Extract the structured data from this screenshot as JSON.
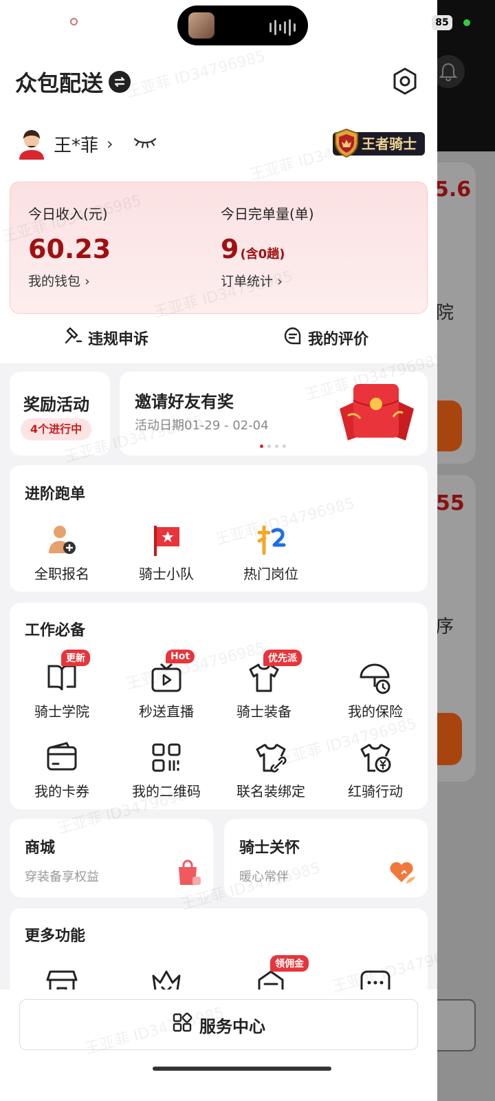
{
  "status": {
    "battery": "85"
  },
  "header": {
    "title": "众包配送"
  },
  "user": {
    "name": "王*菲",
    "chevron": "›",
    "badge": "王者骑士"
  },
  "income": {
    "today_income_label": "今日收入(元)",
    "today_income_value": "60.23",
    "wallet_link": "我的钱包",
    "today_orders_label": "今日完单量(单)",
    "today_orders_value": "9",
    "today_orders_note": "(含0趟)",
    "stats_link": "订单统计",
    "link_arrow": "›"
  },
  "links": {
    "appeal": "违规申诉",
    "reviews": "我的评价"
  },
  "reward": {
    "title": "奖励活动",
    "pill": "4个进行中"
  },
  "invite": {
    "title": "邀请好友有奖",
    "date": "活动日期01-29 - 02-04"
  },
  "advanced": {
    "title": "进阶跑单",
    "items": [
      {
        "label": "全职报名",
        "icon": "fulltime-signup-icon"
      },
      {
        "label": "骑士小队",
        "icon": "knight-team-flag-icon"
      },
      {
        "label": "热门岗位",
        "icon": "hot-jobs-icon"
      }
    ]
  },
  "work": {
    "title": "工作必备",
    "items": [
      {
        "label": "骑士学院",
        "tag": "更新",
        "icon": "academy-book-icon"
      },
      {
        "label": "秒送直播",
        "tag": "Hot",
        "icon": "live-tv-icon"
      },
      {
        "label": "骑士装备",
        "tag": "优先派",
        "icon": "shirt-icon"
      },
      {
        "label": "我的保险",
        "tag": "",
        "icon": "insurance-umbrella-icon"
      },
      {
        "label": "我的卡券",
        "tag": "",
        "icon": "card-icon"
      },
      {
        "label": "我的二维码",
        "tag": "",
        "icon": "qrcode-icon"
      },
      {
        "label": "联名装绑定",
        "tag": "",
        "icon": "shirt-link-icon"
      },
      {
        "label": "红骑行动",
        "tag": "",
        "icon": "shirt-yen-icon"
      }
    ]
  },
  "shop": {
    "title": "商城",
    "subtitle": "穿装备享权益"
  },
  "care": {
    "title": "骑士关怀",
    "subtitle": "暖心常伴"
  },
  "more": {
    "title": "更多功能",
    "items": [
      {
        "label": "",
        "tag": "",
        "icon": "store-icon"
      },
      {
        "label": "",
        "tag": "",
        "icon": "crown-icon"
      },
      {
        "label": "",
        "tag": "领佣金",
        "icon": "commission-icon"
      },
      {
        "label": "",
        "tag": "",
        "icon": "message-icon"
      }
    ]
  },
  "service": {
    "label": "服务中心"
  },
  "watermark": "王亚菲 ID34796985",
  "background_app": {
    "text1": "5.6",
    "text2": "院",
    "text3": "55",
    "text4": "序"
  },
  "colors": {
    "brand_red": "#a01010",
    "tag_red": "#e8343a",
    "pink_card": "#fbe1e2"
  }
}
